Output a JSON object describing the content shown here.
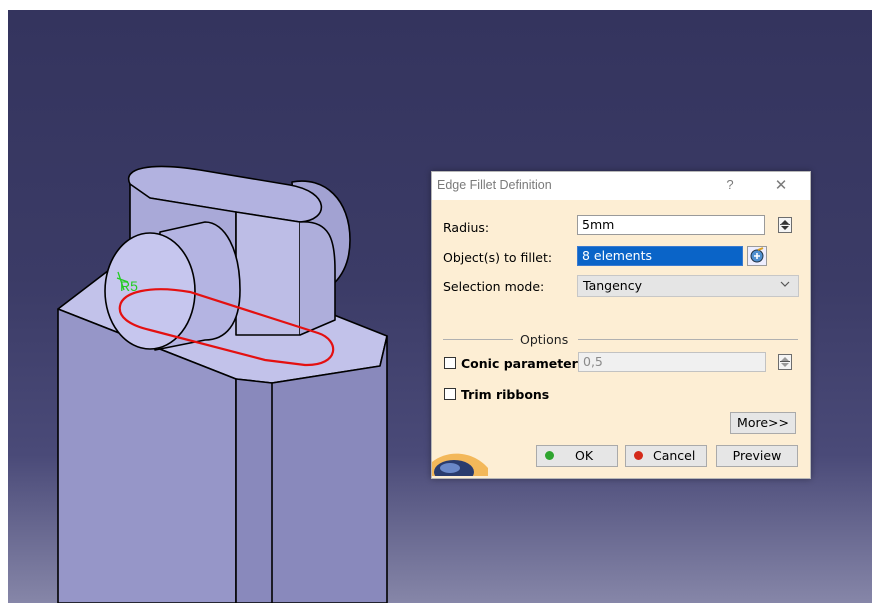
{
  "dialog": {
    "title": "Edge Fillet Definition",
    "help": "?",
    "close": "✕",
    "radius_label": "Radius:",
    "radius_value": "5mm",
    "objects_label": "Object(s) to fillet:",
    "objects_value": "8 elements",
    "selection_mode_label": "Selection mode:",
    "selection_mode_value": "Tangency",
    "options_label": "Options",
    "conic_label": "Conic parameter:",
    "conic_value": "0,5",
    "trim_label": "Trim ribbons",
    "more_button": "More>>",
    "ok_button": "OK",
    "cancel_button": "Cancel",
    "preview_button": "Preview"
  },
  "model": {
    "radius_annotation": "R5"
  },
  "colors": {
    "selection": "#e41010",
    "annotation": "#22cc22",
    "ok_dot": "#2fa52f",
    "cancel_dot": "#d42a1a"
  }
}
